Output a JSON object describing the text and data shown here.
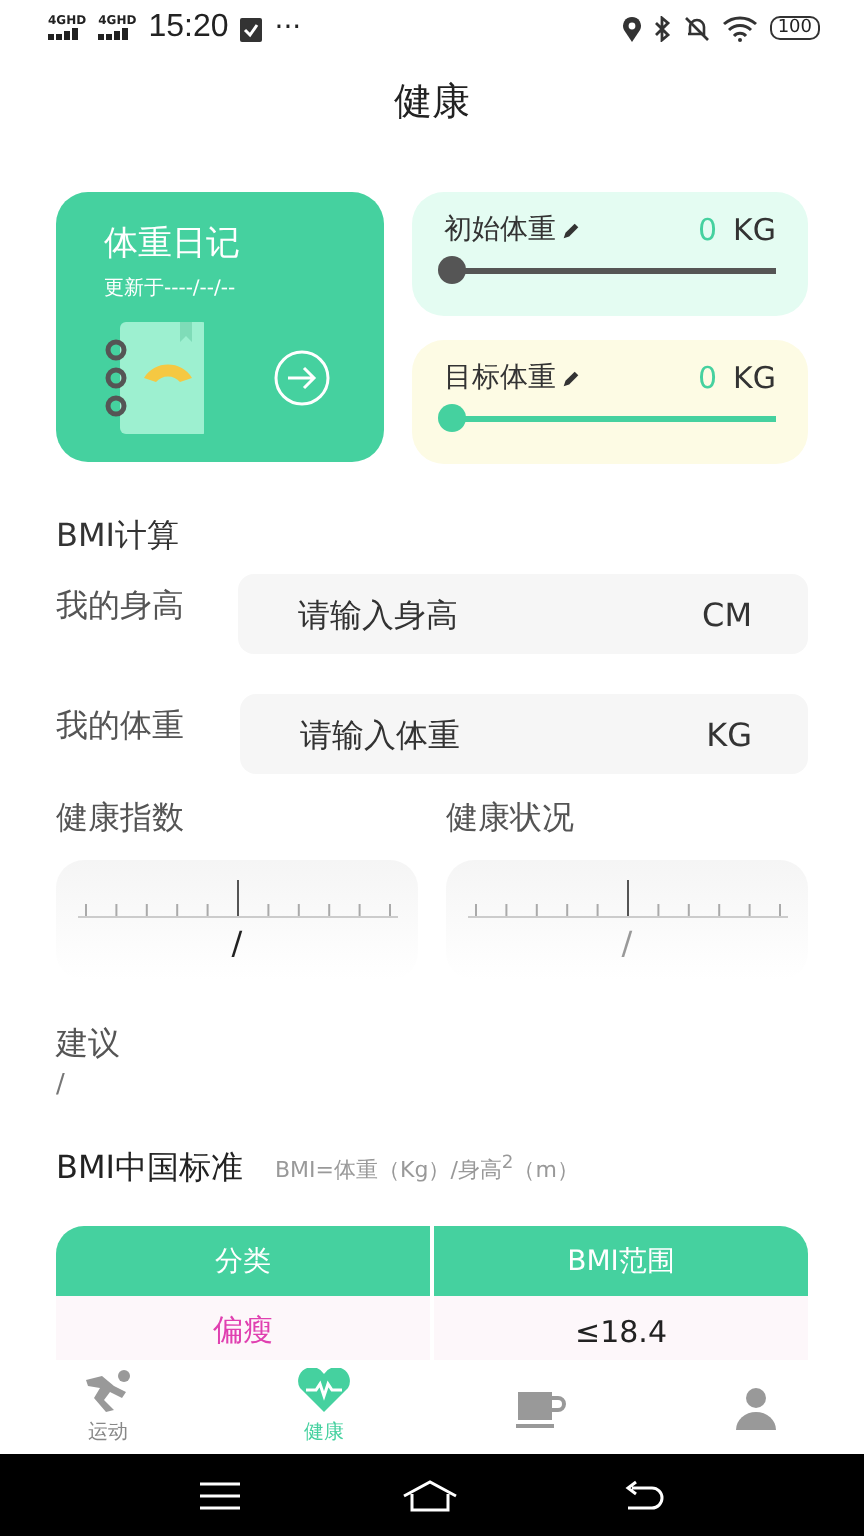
{
  "status_bar": {
    "network_1": "4GHD",
    "network_2": "4GHD",
    "time": "15:20",
    "more": "···",
    "battery": "100"
  },
  "title": "健康",
  "diary": {
    "title": "体重日记",
    "updated": "更新于----/--/--"
  },
  "weights": [
    {
      "kind": "initial",
      "label": "初始体重",
      "value": "0",
      "unit": "KG",
      "level": 0
    },
    {
      "kind": "target",
      "label": "目标体重",
      "value": "0",
      "unit": "KG",
      "level": 0
    }
  ],
  "bmi": {
    "title": "BMI计算",
    "fields": [
      {
        "label": "我的身高",
        "placeholder": "请输入身高",
        "unit": "CM"
      },
      {
        "label": "我的体重",
        "placeholder": "请输入体重",
        "unit": "KG"
      }
    ],
    "gauges": [
      {
        "label": "健康指数",
        "value": "/"
      },
      {
        "label": "健康状况",
        "value": "/"
      }
    ],
    "advice_label": "建议",
    "advice": "/"
  },
  "standard": {
    "title": "BMI中国标准",
    "formula": "BMI=体重（Kg）/身高$^{2}$（m）",
    "columns": [
      "分类",
      "BMI范围"
    ],
    "rows": [
      {
        "category": "偏瘦",
        "range": "≤18.4",
        "color": "#e040b0"
      }
    ]
  },
  "tabs": [
    {
      "kind": "run",
      "label": "运动",
      "selected": false
    },
    {
      "kind": "heart",
      "label": "健康",
      "selected": true
    },
    {
      "kind": "cup",
      "selected": false
    },
    {
      "kind": "person",
      "selected": false
    }
  ]
}
